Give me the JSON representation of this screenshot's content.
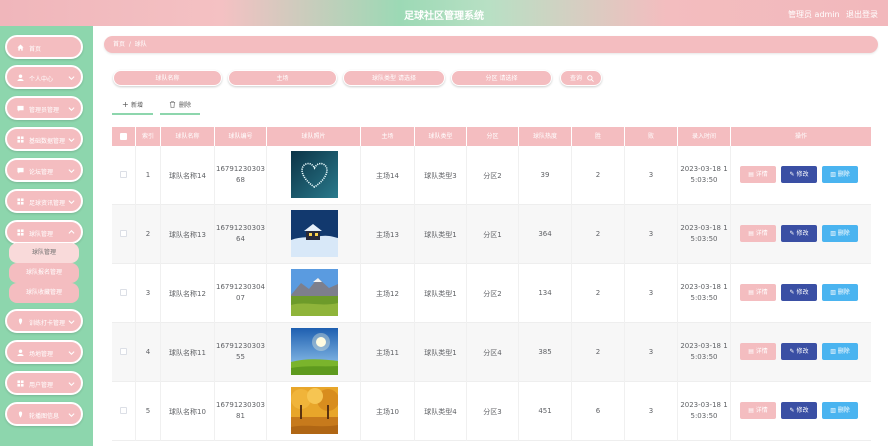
{
  "header": {
    "title": "足球社区管理系统",
    "user": "管理员 admin",
    "logout": "退出登录"
  },
  "sidebar": {
    "items": [
      {
        "label": "首页",
        "icon": "home-icon",
        "chevron": false
      },
      {
        "label": "个人中心",
        "icon": "user-icon",
        "chevron": true
      },
      {
        "label": "管理员管理",
        "icon": "chat-icon",
        "chevron": true
      },
      {
        "label": "基础数据管理",
        "icon": "grid-icon",
        "chevron": true
      },
      {
        "label": "论坛管理",
        "icon": "chat-icon",
        "chevron": true
      },
      {
        "label": "足球资讯管理",
        "icon": "grid-icon",
        "chevron": true
      },
      {
        "label": "球队管理",
        "icon": "grid-icon",
        "chevron": true
      },
      {
        "label": "训练打卡管理",
        "icon": "pin-icon",
        "chevron": true
      },
      {
        "label": "场地管理",
        "icon": "user-icon",
        "chevron": true
      },
      {
        "label": "用户管理",
        "icon": "grid-icon",
        "chevron": true
      },
      {
        "label": "轮播图信息",
        "icon": "pin-icon",
        "chevron": true
      }
    ],
    "submenu": [
      {
        "label": "球队管理",
        "active": true
      },
      {
        "label": "球队报名管理",
        "active": false
      },
      {
        "label": "球队收藏管理",
        "active": false
      }
    ]
  },
  "breadcrumb": {
    "home": "首页",
    "sep": "/",
    "current": "球队"
  },
  "search": {
    "fields": [
      "球队名称",
      "主场",
      "球队类型 请选择",
      "分区 请选择"
    ],
    "query_label": "查询"
  },
  "toolbar": {
    "add_label": "新增",
    "delete_label": "删除"
  },
  "table": {
    "headers": [
      "索引",
      "球队名称",
      "球队编号",
      "球队照片",
      "主场",
      "球队类型",
      "分区",
      "球队热度",
      "胜",
      "败",
      "录入时间",
      "操作"
    ],
    "actions": {
      "detail": "详情",
      "edit": "修改",
      "remove": "删除"
    },
    "rows": [
      {
        "index": "1",
        "name": "球队名称14",
        "code1": "16791230303",
        "code2": "68",
        "photo": "heart-lights",
        "home": "主场14",
        "type": "球队类型3",
        "zone": "分区2",
        "heat": "39",
        "win": "2",
        "loss": "3",
        "time1": "2023-03-18 1",
        "time2": "5:03:50"
      },
      {
        "index": "2",
        "name": "球队名称13",
        "code1": "16791230303",
        "code2": "64",
        "photo": "snow-cabin",
        "home": "主场13",
        "type": "球队类型1",
        "zone": "分区1",
        "heat": "364",
        "win": "2",
        "loss": "3",
        "time1": "2023-03-18 1",
        "time2": "5:03:50"
      },
      {
        "index": "3",
        "name": "球队名称12",
        "code1": "16791230304",
        "code2": "07",
        "photo": "mountain-meadow",
        "home": "主场12",
        "type": "球队类型1",
        "zone": "分区2",
        "heat": "134",
        "win": "2",
        "loss": "3",
        "time1": "2023-03-18 1",
        "time2": "5:03:50"
      },
      {
        "index": "4",
        "name": "球队名称11",
        "code1": "16791230303",
        "code2": "55",
        "photo": "sky-field",
        "home": "主场11",
        "type": "球队类型1",
        "zone": "分区4",
        "heat": "385",
        "win": "2",
        "loss": "3",
        "time1": "2023-03-18 1",
        "time2": "5:03:50"
      },
      {
        "index": "5",
        "name": "球队名称10",
        "code1": "16791230303",
        "code2": "81",
        "photo": "autumn-trees",
        "home": "主场10",
        "type": "球队类型4",
        "zone": "分区3",
        "heat": "451",
        "win": "6",
        "loss": "3",
        "time1": "2023-03-18 1",
        "time2": "5:03:50"
      }
    ]
  },
  "colors": {
    "accent_pink": "#f4bdc0",
    "sidebar_green": "#8dd6ad",
    "edit_blue": "#3a4fa4",
    "delete_blue": "#4ab4f0"
  }
}
